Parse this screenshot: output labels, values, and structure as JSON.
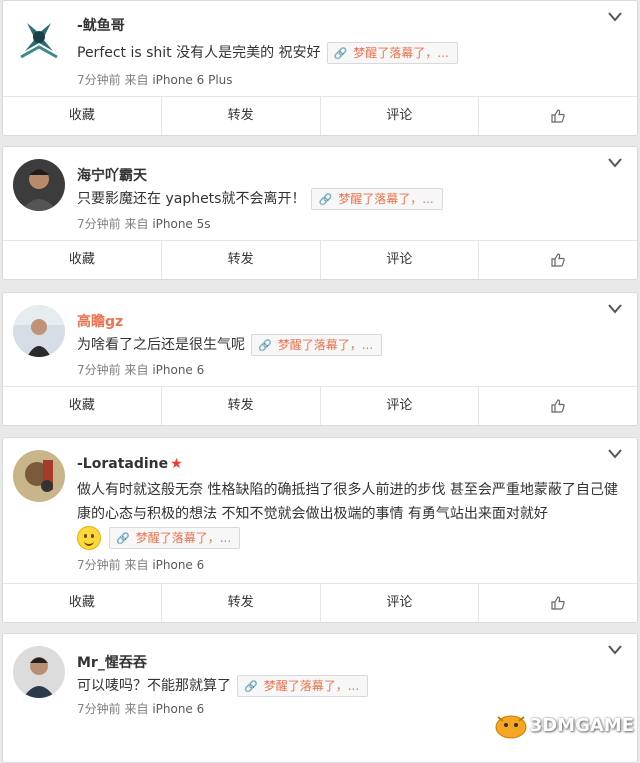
{
  "actions": {
    "collect": "收藏",
    "repost": "转发",
    "comment": "评论"
  },
  "tag_text": "梦醒了落幕了，...",
  "meta_from": "来自",
  "cards": [
    {
      "username": "-鱿鱼哥",
      "text": "Perfect is shit 没有人是完美的 祝安好",
      "time": "7分钟前",
      "device": "iPhone 6 Plus"
    },
    {
      "username": "海宁吖霸天",
      "text": "只要影魔还在 yaphets就不会离开！",
      "time": "7分钟前",
      "device": "iPhone 5s"
    },
    {
      "username": "高瞻gz",
      "text": "为啥看了之后还是很生气呢",
      "time": "7分钟前",
      "device": "iPhone 6"
    },
    {
      "username": "-Loratadine",
      "text": "做人有时就这般无奈 性格缺陷的确抵挡了很多人前进的步伐 甚至会严重地蒙蔽了自己健康的心态与积极的想法 不知不觉就会做出极端的事情 有勇气站出来面对就好",
      "time": "7分钟前",
      "device": "iPhone 6"
    },
    {
      "username": "Mr_惺吞吞",
      "text": "可以唛吗？不能那就算了",
      "time": "7分钟前",
      "device": "iPhone 6"
    }
  ],
  "watermark": "3DMGAME"
}
